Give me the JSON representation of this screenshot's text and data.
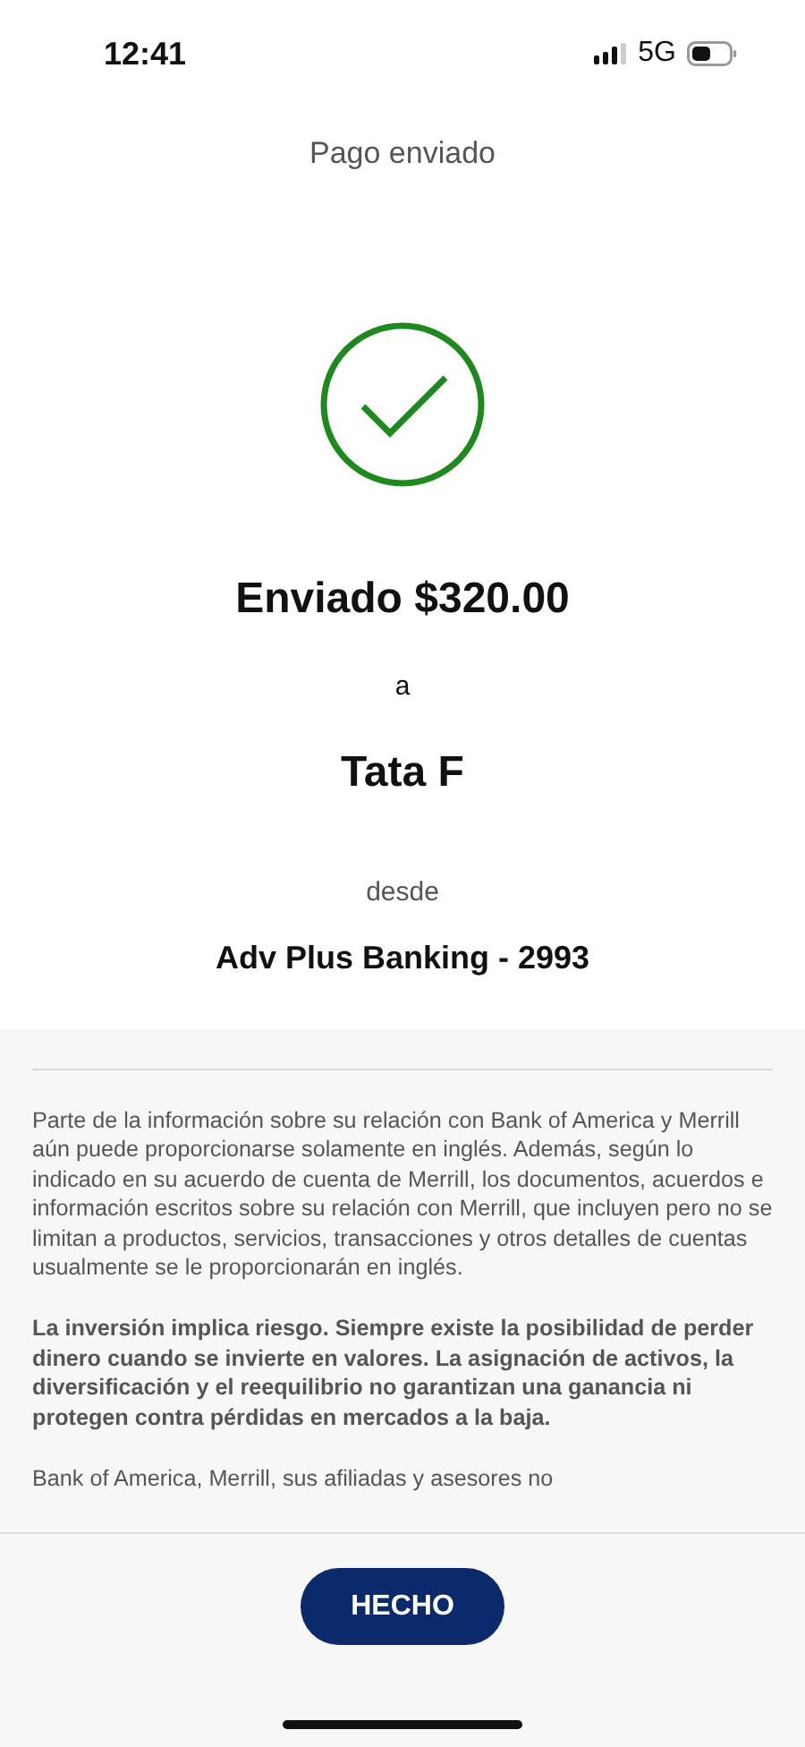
{
  "status_bar": {
    "time": "12:41",
    "network": "5G"
  },
  "header": {
    "title": "Pago enviado"
  },
  "confirmation": {
    "amount_line": "Enviado $320.00",
    "connector": "a",
    "recipient": "Tata F",
    "from_label": "desde",
    "account": "Adv Plus Banking - 2993"
  },
  "disclosures": [
    {
      "kind": "normal",
      "text": "Parte de la información sobre su relación con Bank of America y Merrill aún puede proporcionarse solamente en inglés. Además, según lo indicado en su acuerdo de cuenta de Merrill, los documentos, acuerdos e información escritos sobre su relación con Merrill, que incluyen pero no se limitan a productos, servicios, transacciones y otros detalles de cuentas usualmente se le proporcionarán en inglés."
    },
    {
      "kind": "bold",
      "text": "La inversión implica riesgo. Siempre existe la posibilidad de perder dinero cuando se invierte en valores. La asignación de activos, la diversificación y el reequilibrio no garantizan una ganancia ni protegen contra pérdidas en mercados a la baja."
    },
    {
      "kind": "normal",
      "text": "Bank of America, Merrill, sus afiliadas y asesores no"
    }
  ],
  "footer": {
    "button": "HECHO"
  }
}
